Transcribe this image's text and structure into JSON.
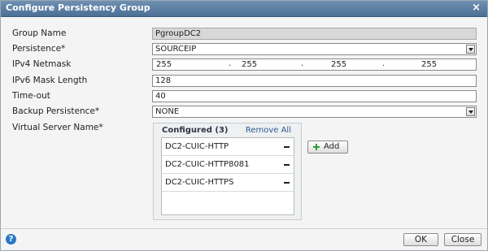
{
  "dialog": {
    "title": "Configure Persistency Group",
    "close_glyph": "×"
  },
  "form": {
    "group_name": {
      "label": "Group Name",
      "value": "PgroupDC2"
    },
    "persistence": {
      "label": "Persistence*",
      "value": "SOURCEIP"
    },
    "ipv4_netmask": {
      "label": "IPv4 Netmask",
      "octets": [
        "255",
        "255",
        "255",
        "255"
      ],
      "separator": "."
    },
    "ipv6_mask_length": {
      "label": "IPv6 Mask Length",
      "value": "128"
    },
    "timeout": {
      "label": "Time-out",
      "value": "40"
    },
    "backup_persistence": {
      "label": "Backup Persistence*",
      "value": "NONE"
    },
    "virtual_server_name": {
      "label": "Virtual Server Name*"
    }
  },
  "virtual_servers": {
    "header": "Configured (3)",
    "remove_all": "Remove All",
    "items": [
      "DC2-CUIC-HTTP",
      "DC2-CUIC-HTTP8081",
      "DC2-CUIC-HTTPS"
    ],
    "add_label": "Add"
  },
  "footer": {
    "help_glyph": "?",
    "ok_label": "OK",
    "close_label": "Close"
  },
  "colors": {
    "titlebar": "#5a7ea4",
    "add_icon": "#2f9b2f",
    "help_icon": "#2b78c6"
  }
}
